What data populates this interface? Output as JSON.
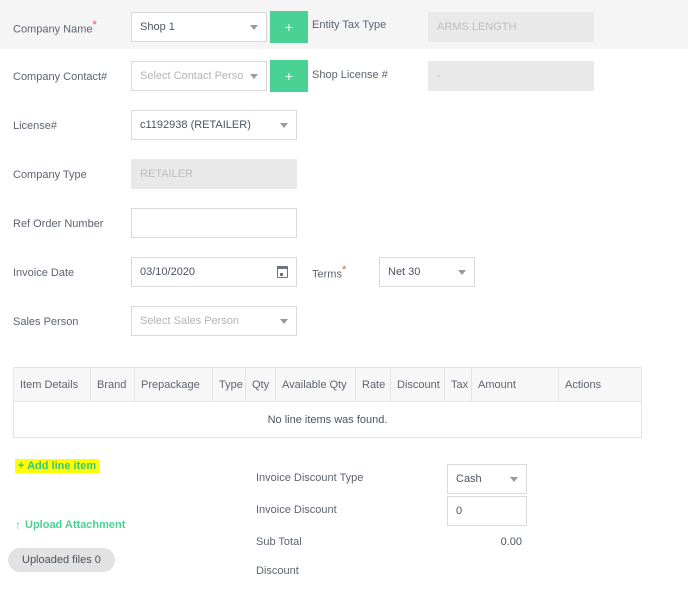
{
  "colors": {
    "accent_green": "#4ad295",
    "highlight_yellow": "#ffff00",
    "required_red": "#e2574c",
    "row_shade": "#f5f5f5",
    "disabled_bg": "#e9e9e9"
  },
  "form": {
    "rows": [
      {
        "label": "Company Name",
        "required": true,
        "control_value": "Shop 1",
        "is_placeholder": false,
        "add_button": "+",
        "right_label": "Entity Tax Type",
        "right_value": "ARMS LENGTH"
      },
      {
        "label": "Company Contact#",
        "required": false,
        "control_value": "Select Contact Person",
        "is_placeholder": true,
        "add_button": "+",
        "right_label": "Shop License #",
        "right_value": "-"
      },
      {
        "label": "License#",
        "required": false,
        "control_value": "c1192938 (RETAILER)",
        "is_placeholder": false
      },
      {
        "label": "Company Type",
        "required": false,
        "control_value": "RETAILER",
        "is_placeholder": true
      },
      {
        "label": "Ref Order Number",
        "required": false,
        "control_value": "",
        "is_placeholder": false
      },
      {
        "label": "Invoice Date",
        "required": false,
        "control_value": "03/10/2020",
        "is_placeholder": false,
        "right_label": "Terms",
        "right_required": true,
        "right_value": "Net 30"
      },
      {
        "label": "Sales Person",
        "required": false,
        "control_value": "Select Sales Person",
        "is_placeholder": true
      }
    ]
  },
  "line_items": {
    "columns": [
      "Item Details",
      "Brand",
      "Prepackage",
      "Type",
      "Qty",
      "Available Qty",
      "Rate",
      "Discount",
      "Tax",
      "Amount",
      "Actions"
    ],
    "rows": [],
    "empty_message": "No line items was found."
  },
  "actions": {
    "add_line_item": "+ Add line item",
    "upload_attachment": "Upload Attachment",
    "upload_arrow": "↑",
    "uploaded_files": "Uploaded files 0"
  },
  "totals": {
    "invoice_discount_type_label": "Invoice Discount Type",
    "invoice_discount_type_value": "Cash",
    "invoice_discount_label": "Invoice Discount",
    "invoice_discount_value": "0",
    "sub_total_label": "Sub Total",
    "sub_total_value": "0.00",
    "discount_label": "Discount",
    "discount_value": ""
  }
}
